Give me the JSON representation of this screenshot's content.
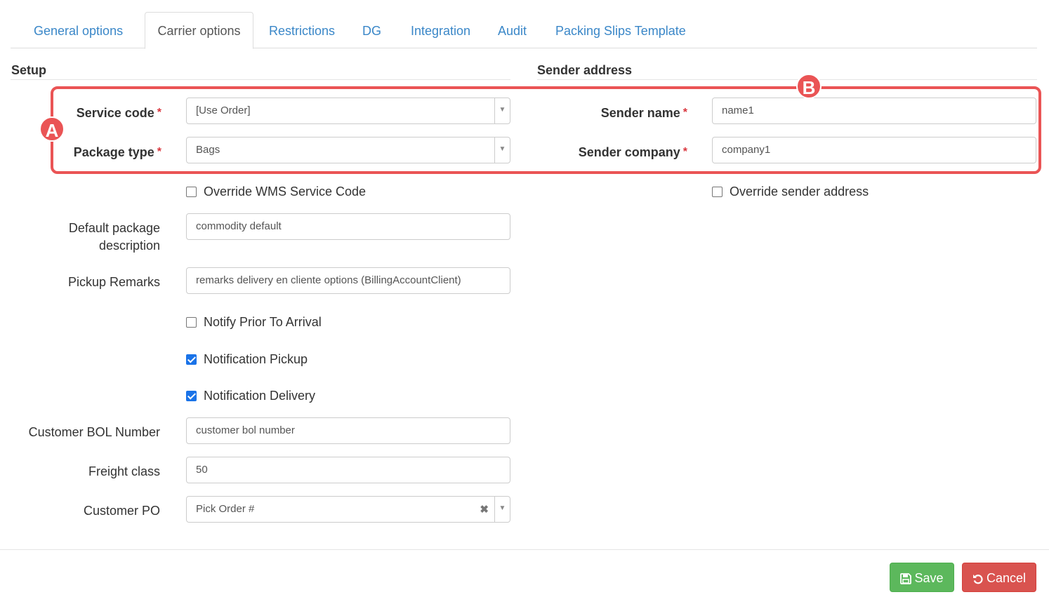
{
  "tabs": [
    "General options",
    "Carrier options",
    "Restrictions",
    "DG",
    "Integration",
    "Audit",
    "Packing Slips Template"
  ],
  "active_tab": "Carrier options",
  "setup": {
    "title": "Setup",
    "service_code": {
      "label": "Service code",
      "value": "[Use Order]"
    },
    "package_type": {
      "label": "Package type",
      "value": "Bags"
    },
    "override_wms": {
      "label": "Override WMS Service Code",
      "checked": false
    },
    "default_package_description": {
      "label_line1": "Default package",
      "label_line2": "description",
      "value": "commodity default"
    },
    "pickup_remarks": {
      "label": "Pickup Remarks",
      "value": "remarks delivery en cliente options (BillingAccountClient)"
    },
    "notify_prior": {
      "label": "Notify Prior To Arrival",
      "checked": false
    },
    "notification_pickup": {
      "label": "Notification Pickup",
      "checked": true
    },
    "notification_delivery": {
      "label": "Notification Delivery",
      "checked": true
    },
    "customer_bol": {
      "label": "Customer BOL Number",
      "value": "customer bol number"
    },
    "freight_class": {
      "label": "Freight class",
      "value": "50"
    },
    "customer_po": {
      "label": "Customer PO",
      "value": "Pick Order #"
    }
  },
  "sender": {
    "title": "Sender address",
    "sender_name": {
      "label": "Sender name",
      "value": "name1"
    },
    "sender_company": {
      "label": "Sender company",
      "value": "company1"
    },
    "override_sender": {
      "label": "Override sender address",
      "checked": false
    }
  },
  "required_mark": "*",
  "annotations": {
    "a": "A",
    "b": "B"
  },
  "buttons": {
    "save": "Save",
    "cancel": "Cancel"
  },
  "colors": {
    "link": "#3a87c8",
    "annotation": "#ea5455",
    "save": "#5cb85c",
    "cancel": "#d9534f",
    "checkbox": "#1a73e8"
  }
}
